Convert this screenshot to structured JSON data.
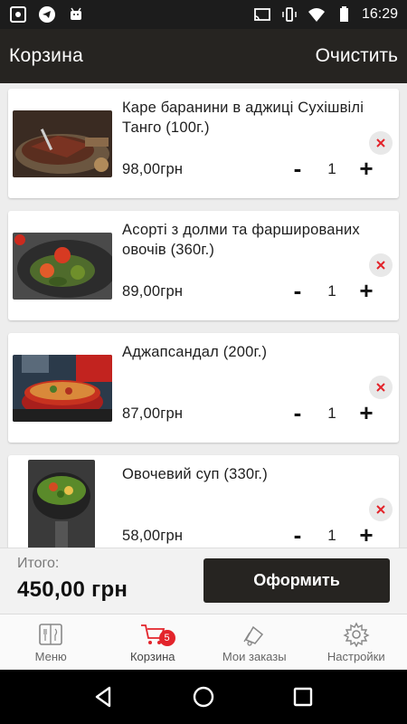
{
  "status_bar": {
    "time": "16:29",
    "icons": [
      "screenshot-icon",
      "telegram-icon",
      "android-icon",
      "cast-icon",
      "vibrate-icon",
      "wifi-icon",
      "battery-icon"
    ]
  },
  "header": {
    "title": "Корзина",
    "clear_label": "Очистить"
  },
  "cart": {
    "items": [
      {
        "title": "Каре баранини в аджиці Сухішвілі Танго (100г.)",
        "price": "98,00грн",
        "quantity": "1",
        "image": "lamb-rack-dish"
      },
      {
        "title": "Асорті з долми та фаршированих овочів (360г.)",
        "price": "89,00грн",
        "quantity": "1",
        "image": "dolma-assorti-dish"
      },
      {
        "title": "Аджапсандал (200г.)",
        "price": "87,00грн",
        "quantity": "1",
        "image": "ajapsandali-dish"
      },
      {
        "title": "Овочевий суп (330г.)",
        "price": "58,00грн",
        "quantity": "1",
        "image": "vegetable-soup-dish"
      }
    ],
    "minus_symbol": "-",
    "plus_symbol": "+"
  },
  "summary": {
    "total_label": "Итого:",
    "total_value": "450,00 грн",
    "checkout_label": "Оформить"
  },
  "bottom_nav": {
    "items": [
      {
        "label": "Меню",
        "icon": "menu-book-icon"
      },
      {
        "label": "Корзина",
        "icon": "cart-icon",
        "badge": "5"
      },
      {
        "label": "Мои заказы",
        "icon": "orders-icon"
      },
      {
        "label": "Настройки",
        "icon": "gear-icon"
      }
    ]
  },
  "colors": {
    "app_bar": "#262421",
    "accent_red": "#e3242b",
    "background": "#ededed"
  }
}
